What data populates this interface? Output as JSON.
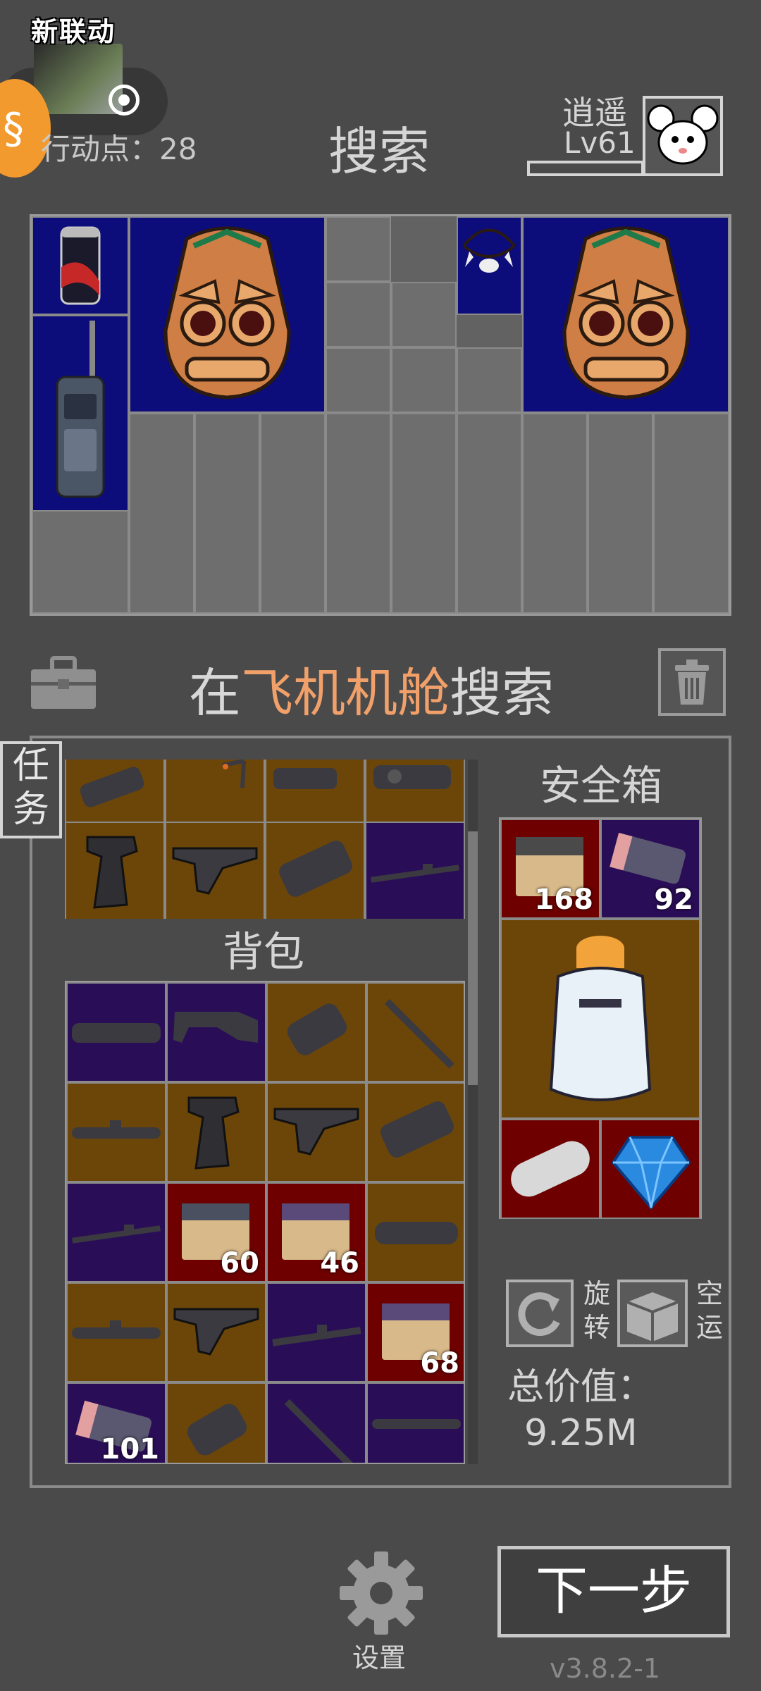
{
  "header": {
    "promo_title": "新联动",
    "action_points_label": "行动点：28",
    "title": "搜索",
    "player_name": "逍遥",
    "player_level": "Lv61"
  },
  "search": {
    "prefix": "在",
    "location": "飞机机舱",
    "suffix": "搜索"
  },
  "task_tab": {
    "line1": "任",
    "line2": "务"
  },
  "inventory": {
    "backpack_label": "背包",
    "safe_box_label": "安全箱",
    "rotate_label_1": "旋",
    "rotate_label_2": "转",
    "empty_label_1": "空",
    "empty_label_2": "运",
    "total_value_label": "总价值：",
    "total_value": "9.25M",
    "backpack_counts": {
      "box1": "60",
      "box2": "46",
      "box3": "68",
      "battery": "101"
    },
    "safe_counts": {
      "box": "168",
      "battery": "92"
    }
  },
  "footer": {
    "settings_label": "设置",
    "next_button": "下一步",
    "version": "v3.8.2-1"
  },
  "icons": [
    "soda-can-icon",
    "tiki-mask-icon",
    "claw-necklace-icon",
    "walkie-talkie-icon",
    "toolbox-icon",
    "trash-icon",
    "gun-grip-icon",
    "foregrip-icon",
    "flashlight-icon",
    "scope-icon",
    "silencer-icon",
    "muzzle-brake-icon",
    "stock-icon",
    "rifle-barrel-icon",
    "ammo-box-icon",
    "battery-icon",
    "dewar-flask-icon",
    "capsule-icon",
    "blue-gem-icon",
    "rotate-icon",
    "box-icon",
    "gear-icon"
  ],
  "colors": {
    "accent_location": "#f2a06a",
    "slot_navy": "#0c0c7a",
    "slot_brown": "#6c4609",
    "slot_purple": "#2a0d57",
    "slot_red": "#6e0000"
  }
}
